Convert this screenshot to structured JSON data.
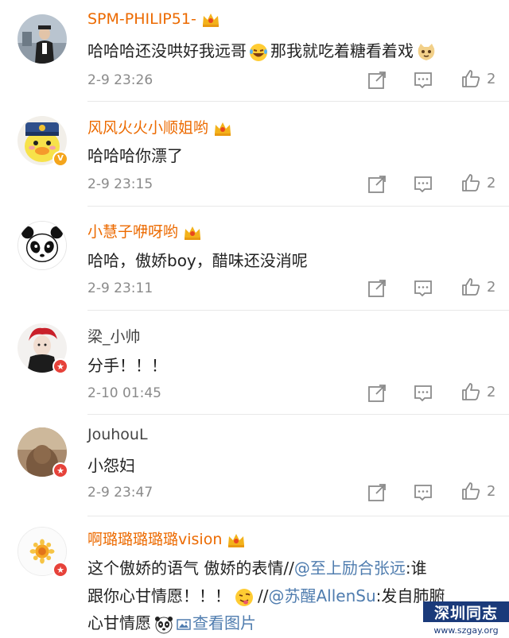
{
  "comments": [
    {
      "username": "SPM-PHILIP51-",
      "text_part1": "哈哈哈还没哄好我远哥",
      "text_part2": "那我就吃着糖看着戏",
      "time": "2-9 23:26",
      "likes": "2"
    },
    {
      "username": "风风火火小顺姐哟",
      "text": "哈哈哈你漂了",
      "time": "2-9 23:15",
      "likes": "2"
    },
    {
      "username": "小慧子咿呀哟",
      "text": "哈哈，傲娇boy，醋味还没消呢",
      "time": "2-9 23:11",
      "likes": "2"
    },
    {
      "username": "梁_小帅",
      "text": "分手！！！",
      "time": "2-10 01:45",
      "likes": "2"
    },
    {
      "username": "JouhouL",
      "text": "小怨妇",
      "time": "2-9 23:47",
      "likes": "2"
    },
    {
      "username": "啊璐璐璐璐璐vision",
      "line1_a": "这个傲娇的语气 傲娇的表情//",
      "line1_mention": "@至上励合张远",
      "line1_b": ":谁",
      "line2_a": "跟你心甘情愿！！！",
      "line2_b": "//",
      "line2_mention": "@苏醒AllenSu",
      "line2_c": ":发自肺腑",
      "line3_a": "心甘情愿",
      "line3_link": "查看图片"
    }
  ],
  "watermark": {
    "title": "深圳同志",
    "url": "www.szgay.org"
  },
  "colors": {
    "vip_name": "#ec6a00",
    "link": "#507daf",
    "meta": "#8a8a8a"
  }
}
